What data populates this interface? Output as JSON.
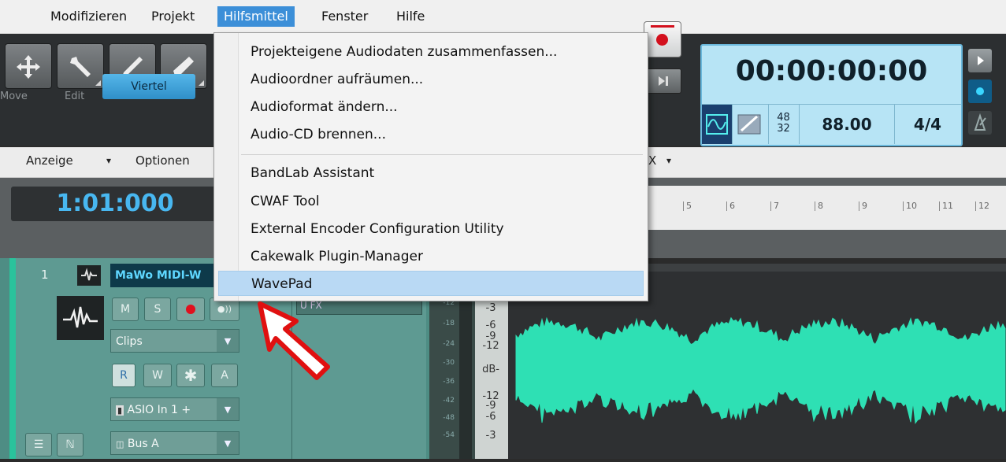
{
  "menubar": {
    "items": [
      "Modifizieren",
      "Projekt",
      "Hilfsmittel",
      "Fenster",
      "Hilfe"
    ],
    "active": "Hilfsmittel"
  },
  "toolbar": {
    "tools": [
      "Move",
      "Edit",
      "Draw",
      "Erase"
    ],
    "snap_value": "Viertel"
  },
  "clock": {
    "time": "00:00:00:00",
    "meter_top": "48",
    "meter_bottom": "32",
    "tempo": "88.00",
    "signature": "4/4"
  },
  "controlbar": {
    "anzeige": "Anzeige",
    "optionen": "Optionen",
    "fx_label": "X"
  },
  "now_time": "1:01:000",
  "ruler_ticks": [
    "5",
    "6",
    "7",
    "8",
    "9",
    "10",
    "11",
    "12"
  ],
  "track": {
    "number": "1",
    "name": "MaWo MIDI-W",
    "mute": "M",
    "solo": "S",
    "clips_dropdown": "Clips",
    "read": "R",
    "write": "W",
    "input_echo": "A",
    "input": "ASIO In 1 +",
    "output": "Bus A",
    "fx_bin": "U FX"
  },
  "meter_scale": [
    "-3",
    "-6",
    "-9",
    "-12",
    "dB-",
    "-12",
    "-9",
    "-6",
    "-3"
  ],
  "meter_ticks": [
    "-12",
    "-18",
    "-24",
    "-30",
    "-36",
    "-42",
    "-48",
    "-54"
  ],
  "menu": {
    "items": [
      {
        "label": "Projekteigene Audiodaten zusammenfassen..."
      },
      {
        "label": "Audioordner aufräumen..."
      },
      {
        "label": "Audioformat ändern..."
      },
      {
        "label": "Audio-CD brennen..."
      },
      {
        "label": "BandLab Assistant"
      },
      {
        "label": "CWAF Tool"
      },
      {
        "label": "External Encoder Configuration Utility"
      },
      {
        "label": "Cakewalk Plugin-Manager"
      },
      {
        "label": "WavePad"
      }
    ],
    "highlighted": "WavePad"
  },
  "colors": {
    "menu_highlight": "#b9d9f4",
    "menubar_active": "#3c8fd8",
    "waveform": "#2ee0b4",
    "arrow": "#e01010"
  }
}
